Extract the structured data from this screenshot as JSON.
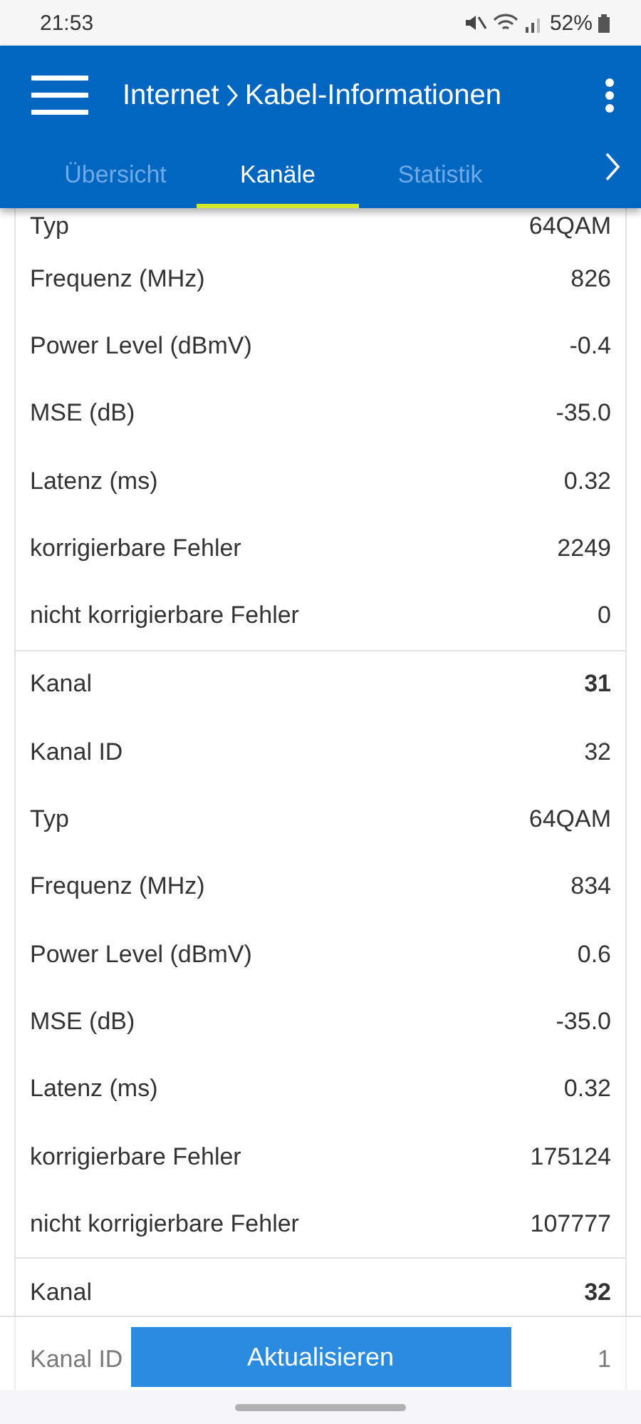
{
  "status_bar": {
    "time": "21:53",
    "battery": "52%"
  },
  "header": {
    "breadcrumb": [
      "Internet",
      "Kabel-Informationen"
    ]
  },
  "tabs": [
    {
      "label": "Übersicht",
      "selected": false
    },
    {
      "label": "Kanäle",
      "selected": true
    },
    {
      "label": "Statistik",
      "selected": false
    }
  ],
  "groups": [
    {
      "rows": [
        {
          "kind": "field",
          "label": "Typ",
          "value": "64QAM"
        },
        {
          "kind": "field",
          "label": "Frequenz (MHz)",
          "value": "826"
        },
        {
          "kind": "field",
          "label": "Power Level (dBmV)",
          "value": "-0.4"
        },
        {
          "kind": "field",
          "label": "MSE (dB)",
          "value": "-35.0"
        },
        {
          "kind": "field",
          "label": "Latenz (ms)",
          "value": "0.32"
        },
        {
          "kind": "field",
          "label": "korrigierbare Fehler",
          "value": "2249"
        },
        {
          "kind": "field",
          "label": "nicht korrigierbare Fehler",
          "value": "0"
        }
      ]
    },
    {
      "rows": [
        {
          "kind": "channel",
          "label": "Kanal",
          "value": "31"
        },
        {
          "kind": "field",
          "label": "Kanal ID",
          "value": "32"
        },
        {
          "kind": "field",
          "label": "Typ",
          "value": "64QAM"
        },
        {
          "kind": "field",
          "label": "Frequenz (MHz)",
          "value": "834"
        },
        {
          "kind": "field",
          "label": "Power Level (dBmV)",
          "value": "0.6"
        },
        {
          "kind": "field",
          "label": "MSE (dB)",
          "value": "-35.0"
        },
        {
          "kind": "field",
          "label": "Latenz (ms)",
          "value": "0.32"
        },
        {
          "kind": "field",
          "label": "korrigierbare Fehler",
          "value": "175124"
        },
        {
          "kind": "field",
          "label": "nicht korrigierbare Fehler",
          "value": "107777"
        }
      ]
    },
    {
      "rows": [
        {
          "kind": "channel",
          "label": "Kanal",
          "value": "32"
        },
        {
          "kind": "field",
          "label": "Kanal ID",
          "value": "1"
        }
      ]
    }
  ],
  "footer": {
    "button": "Aktualisieren"
  }
}
